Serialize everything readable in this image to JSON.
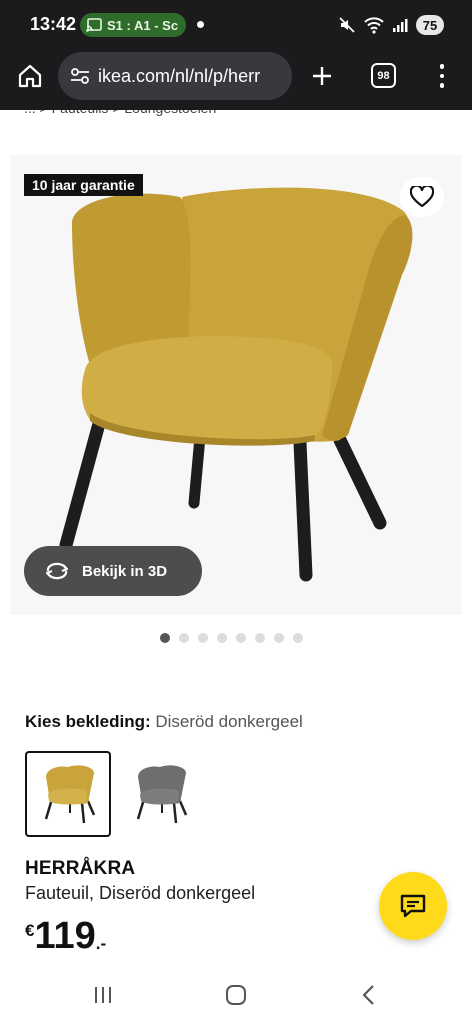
{
  "status_bar": {
    "time": "13:42",
    "cast_label": "S1 : A1 - Sc",
    "battery": "75"
  },
  "browser": {
    "url": "ikea.com/nl/nl/p/herr",
    "tab_count": "98"
  },
  "breadcrumb": {
    "text": "... > Fauteuils > Loungestoelen"
  },
  "product_image": {
    "badge": "10 jaar garantie",
    "view_3d_label": "Bekijk in 3D",
    "carousel_total": 8,
    "carousel_active": 1
  },
  "options": {
    "label": "Kies bekleding:",
    "selected_value": "Diseröd donkergeel",
    "swatches": [
      {
        "name": "yellow",
        "color": "#c9a43a",
        "selected": true
      },
      {
        "name": "grey",
        "color": "#6e6e6e",
        "selected": false
      }
    ]
  },
  "product": {
    "name": "HERRÅKRA",
    "description": "Fauteuil, Diseröd donkergeel",
    "price_currency": "€",
    "price_amount": "119",
    "price_suffix": ".-"
  },
  "colors": {
    "chair_yellow": "#c9a43a",
    "chat_yellow": "#ffda1a",
    "browser_bg": "#1b1b1d"
  }
}
